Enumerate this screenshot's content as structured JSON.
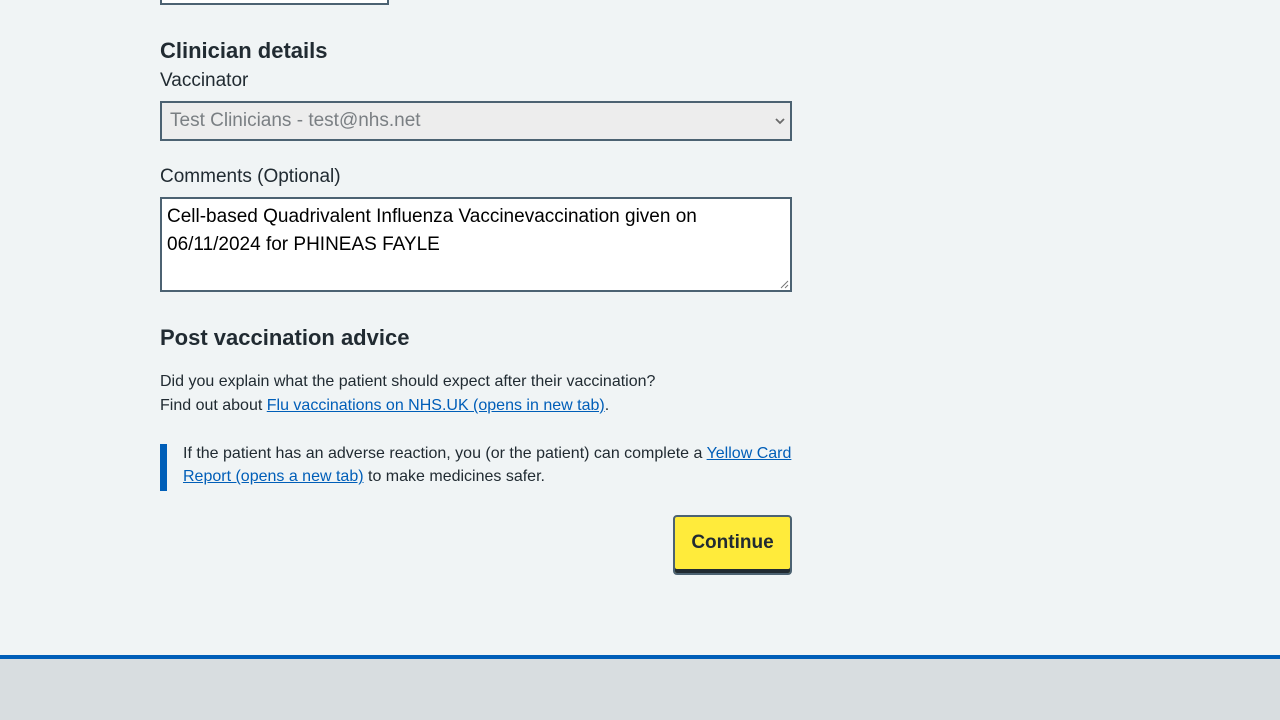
{
  "clinician": {
    "heading": "Clinician details",
    "vaccinator_label": "Vaccinator",
    "vaccinator_selected": "Test Clinicians - test@nhs.net"
  },
  "comments": {
    "label": "Comments (Optional)",
    "value": "Cell-based Quadrivalent Influenza Vaccinevaccination given on 06/11/2024 for PHINEAS FAYLE"
  },
  "post_vaccination": {
    "heading": "Post vaccination advice",
    "question": "Did you explain what the patient should expect after their vaccination?",
    "find_out_prefix": "Find out about ",
    "find_out_link": "Flu vaccinations on NHS.UK (opens in new tab)",
    "find_out_suffix": ".",
    "inset_prefix": "If the patient has an adverse reaction, you (or the patient) can complete a ",
    "inset_link": "Yellow Card Report (opens a new tab)",
    "inset_suffix": " to make medicines safer."
  },
  "actions": {
    "continue_label": "Continue"
  },
  "icons": {
    "select_chevron": "chevron-down-icon",
    "resize": "resize-handle-icon"
  },
  "colors": {
    "background": "#f0f4f5",
    "link": "#005eb8",
    "button": "#ffeb3b",
    "footer": "#d8dde0"
  }
}
